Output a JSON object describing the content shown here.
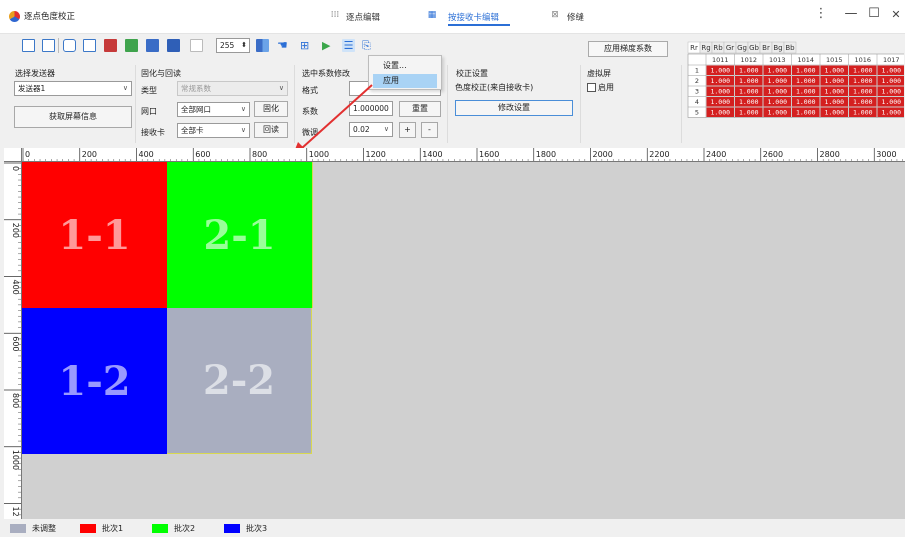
{
  "window": {
    "title": "逐点色度校正",
    "minimize": "—",
    "maximize": "☐",
    "close": "✕",
    "more": "⋮"
  },
  "tabs": [
    {
      "label": "逐点编辑",
      "icon": "grid-icon"
    },
    {
      "label": "按接收卡编辑",
      "icon": "receiver-grid-icon",
      "active": true
    },
    {
      "label": "修缝",
      "icon": "seam-icon"
    }
  ],
  "toolbar": {
    "brightness_value": "255",
    "apply_gradient_label": "应用梯度系数"
  },
  "context_menu": {
    "items": [
      "设置...",
      "应用"
    ],
    "highlighted": 1
  },
  "sender": {
    "group_label": "选择发送器",
    "selected": "发送器1",
    "get_info_label": "获取屏幕信息"
  },
  "solidify": {
    "group_label": "固化与回读",
    "type_label": "类型",
    "type_value": "常规系数",
    "port_label": "网口",
    "port_value": "全部网口",
    "solidify_btn": "固化",
    "card_label": "接收卡",
    "card_value": "全部卡",
    "readback_btn": "回读"
  },
  "coef": {
    "group_label": "选中系数修改",
    "format_label": "格式",
    "coef_label": "系数",
    "coef_value": "1.000000",
    "reset_btn": "重置",
    "fine_label": "微调",
    "fine_value": "0.02",
    "plus": "+",
    "minus": "-"
  },
  "calibration": {
    "group_label": "校正设置",
    "mode_text": "色度校正(来自接收卡)",
    "modify_btn": "修改设置"
  },
  "virtual": {
    "group_label": "虚拟屏",
    "enable_label": "启用"
  },
  "coef_grid": {
    "tabs": [
      "Rr",
      "Rg",
      "Rb",
      "Gr",
      "Gg",
      "Gb",
      "Br",
      "Bg",
      "Bb"
    ],
    "columns": [
      "1011",
      "1012",
      "1013",
      "1014",
      "1015",
      "1016",
      "1017"
    ],
    "rows": [
      "1",
      "2",
      "3",
      "4",
      "5"
    ],
    "value": "1.000",
    "cell_color": "#d42020"
  },
  "ruler_h": [
    "0",
    "200",
    "400",
    "600",
    "800",
    "1000",
    "1200",
    "1400",
    "1600",
    "1800",
    "2000",
    "2200",
    "2400",
    "2600",
    "2800",
    "3000"
  ],
  "ruler_v": [
    "0",
    "200",
    "400",
    "600",
    "800",
    "1000",
    "12"
  ],
  "cells": [
    {
      "label": "1-1",
      "color": "#ff0000"
    },
    {
      "label": "2-1",
      "color": "#00ff00"
    },
    {
      "label": "1-2",
      "color": "#0000ff"
    },
    {
      "label": "2-2",
      "color": "#a9aec0"
    }
  ],
  "legend": [
    {
      "label": "未调整",
      "color": "#a9aec0"
    },
    {
      "label": "批次1",
      "color": "#ff0000"
    },
    {
      "label": "批次2",
      "color": "#00ff00"
    },
    {
      "label": "批次3",
      "color": "#0000ff"
    }
  ]
}
